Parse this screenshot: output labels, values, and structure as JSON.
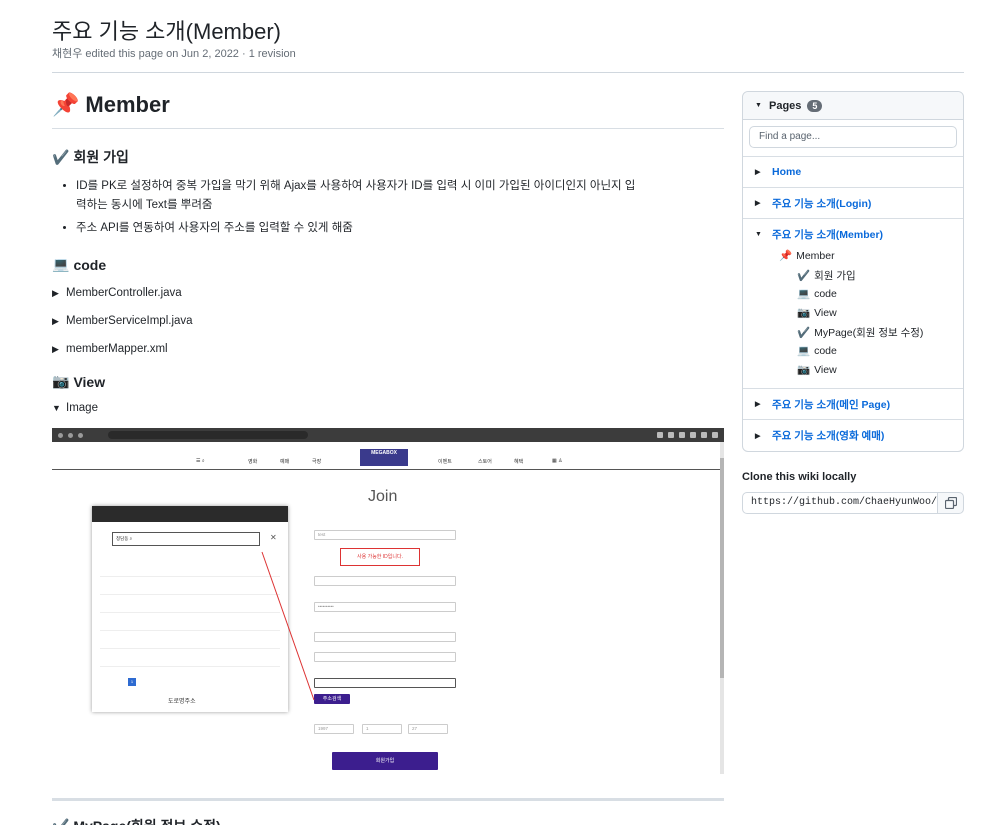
{
  "page": {
    "title": "주요 기능 소개(Member)",
    "meta": "채현우 edited this page on Jun 2, 2022 · 1 revision"
  },
  "content": {
    "h1_icon": "📌",
    "h1": "Member",
    "signup": {
      "icon": "✔️",
      "heading": "회원 가입",
      "bullets": [
        "ID를 PK로 설정하여 중복 가입을 막기 위해 Ajax를 사용하여 사용자가 ID를 입력 시 이미 가입된 아이디인지 아닌지 입력하는 동시에 Text를 뿌려줌",
        "주소 API를 연동하여 사용자의 주소를 입력할 수 있게 해줌"
      ]
    },
    "code": {
      "icon": "💻",
      "heading": "code",
      "files": [
        "MemberController.java",
        "MemberServiceImpl.java",
        "memberMapper.xml"
      ]
    },
    "view": {
      "icon": "📷",
      "heading": "View",
      "image_summary": "Image"
    },
    "screenshot": {
      "join_title": "Join",
      "id_check_text": "사용 가능한 ID입니다.",
      "address_search_button": "주소검색",
      "submit_button": "회원가입",
      "popup_footer": "도로명주소",
      "birth": {
        "year": "1997",
        "month": "1",
        "day": "27"
      }
    },
    "next_heading_partial": "✔️ MyPage(회원 정보 수정)"
  },
  "sidebar": {
    "pages_label": "Pages",
    "pages_count": "5",
    "find_placeholder": "Find a page...",
    "pages": [
      "Home",
      "주요 기능 소개(Login)",
      "주요 기능 소개(Member)",
      "주요 기능 소개(메인 Page)",
      "주요 기능 소개(영화 예매)"
    ],
    "member_toc": [
      {
        "icon": "📌",
        "label": "Member"
      },
      {
        "icon": "✔️",
        "label": "회원 가입"
      },
      {
        "icon": "💻",
        "label": "code"
      },
      {
        "icon": "📷",
        "label": "View"
      },
      {
        "icon": "✔️",
        "label": "MyPage(회원 정보 수정)"
      },
      {
        "icon": "💻",
        "label": "code"
      },
      {
        "icon": "📷",
        "label": "View"
      }
    ],
    "clone_label": "Clone this wiki locally",
    "clone_url": "https://github.com/ChaeHyunWoo/Sp"
  },
  "colors": {
    "link": "#0969da",
    "accent_purple": "#3c1e8e",
    "red_box": "#dd3333"
  }
}
